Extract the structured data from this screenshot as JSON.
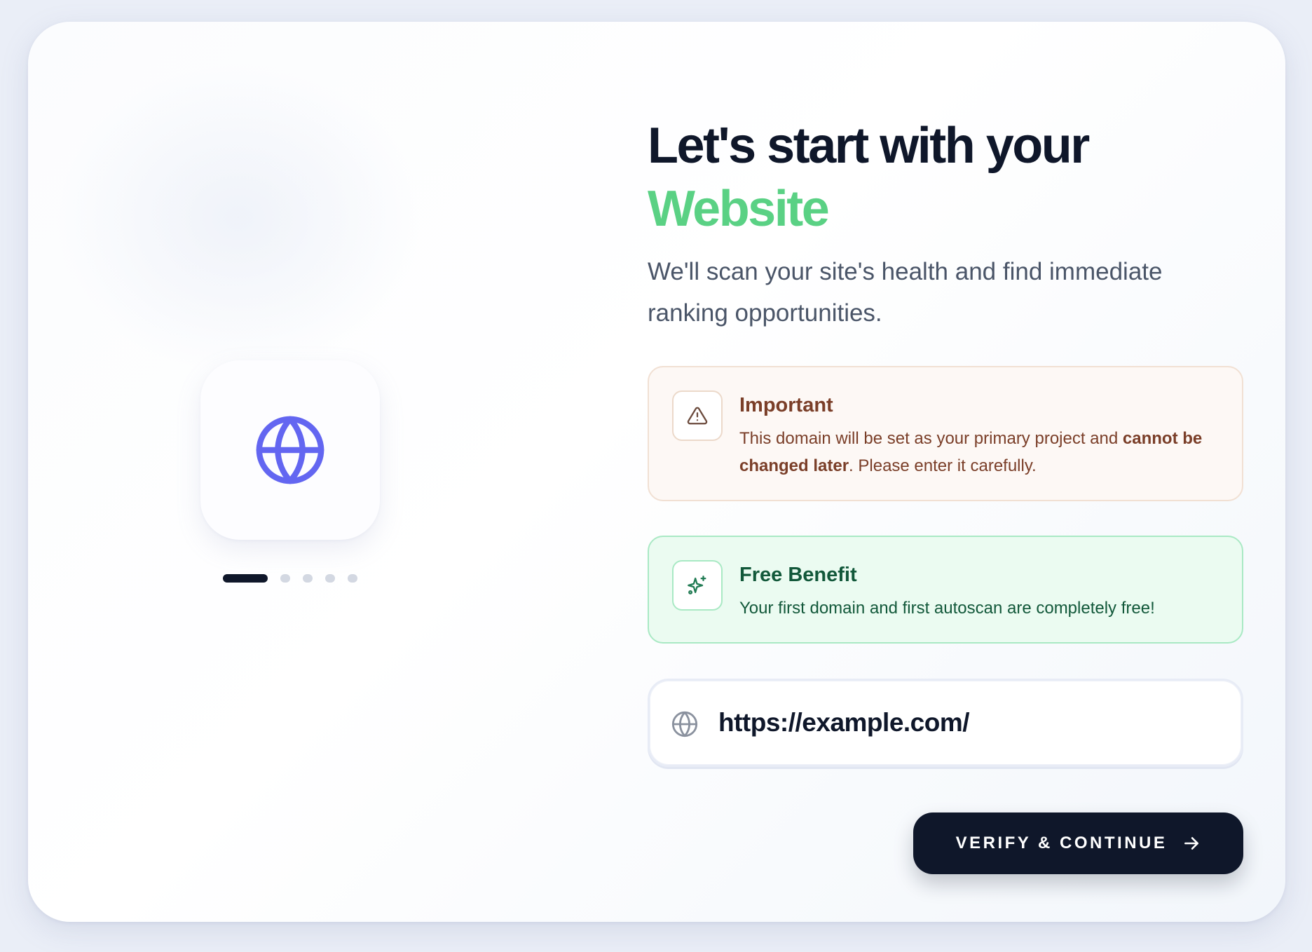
{
  "hero": {
    "title_line1": "Let's start with your",
    "title_accent": "Website",
    "subtitle": "We'll scan your site's health and find immediate ranking opportunities."
  },
  "carousel": {
    "icon": "globe-icon",
    "steps_total": 5,
    "active_step": 1
  },
  "important": {
    "icon": "warning-triangle-icon",
    "title": "Important",
    "text_before": "This domain will be set as your primary project and ",
    "text_bold": "cannot be changed later",
    "text_after": ". Please enter it carefully."
  },
  "benefit": {
    "icon": "sparkles-icon",
    "title": "Free Benefit",
    "text": "Your first domain and first autoscan are completely free!"
  },
  "url_input": {
    "icon": "globe-icon",
    "value": "https://example.com/"
  },
  "cta": {
    "label": "VERIFY & CONTINUE",
    "icon": "arrow-right-icon"
  },
  "colors": {
    "accent_green": "#5ad184",
    "primary_dark": "#0f172a",
    "globe_purple": "#6366f1"
  }
}
